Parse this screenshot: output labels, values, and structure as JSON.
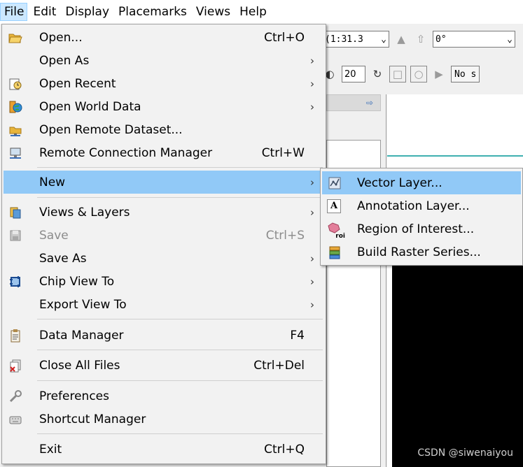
{
  "menubar": {
    "items": [
      {
        "label": "File",
        "active": true
      },
      {
        "label": "Edit"
      },
      {
        "label": "Display"
      },
      {
        "label": "Placemarks"
      },
      {
        "label": "Views"
      },
      {
        "label": "Help"
      }
    ]
  },
  "toolbar": {
    "scale_value": "(1:31.3",
    "rotation_value": "0°",
    "stretch_value": "20",
    "no_stretch_label": "No s"
  },
  "file_menu": {
    "items": [
      {
        "label": "Open...",
        "shortcut": "Ctrl+O",
        "icon": "folder-open-icon"
      },
      {
        "label": "Open As",
        "submenu": true
      },
      {
        "label": "Open Recent",
        "submenu": true,
        "icon": "recent-icon"
      },
      {
        "label": "Open World Data",
        "submenu": true,
        "icon": "globe-icon"
      },
      {
        "label": "Open Remote Dataset...",
        "icon": "remote-dataset-icon"
      },
      {
        "label": "Remote Connection Manager",
        "shortcut": "Ctrl+W",
        "icon": "monitor-icon"
      },
      {
        "label": "New",
        "submenu": true,
        "highlighted": true
      },
      {
        "label": "Views & Layers",
        "submenu": true,
        "icon": "layers-icon"
      },
      {
        "label": "Save",
        "shortcut": "Ctrl+S",
        "disabled": true,
        "icon": "save-icon"
      },
      {
        "label": "Save As",
        "submenu": true
      },
      {
        "label": "Chip View To",
        "submenu": true,
        "icon": "chip-icon"
      },
      {
        "label": "Export View To",
        "submenu": true
      },
      {
        "label": "Data Manager",
        "shortcut": "F4",
        "icon": "clipboard-icon"
      },
      {
        "label": "Close All Files",
        "shortcut": "Ctrl+Del",
        "icon": "close-files-icon"
      },
      {
        "label": "Preferences",
        "icon": "wrench-icon"
      },
      {
        "label": "Shortcut Manager",
        "icon": "keyboard-icon"
      },
      {
        "label": "Exit",
        "shortcut": "Ctrl+Q"
      }
    ]
  },
  "new_submenu": {
    "items": [
      {
        "label": "Vector Layer...",
        "highlighted": true,
        "icon": "vector-layer-icon"
      },
      {
        "label": "Annotation Layer...",
        "icon": "annotation-icon",
        "icon_text": "A"
      },
      {
        "label": "Region of Interest...",
        "icon": "roi-icon",
        "icon_text": "roi"
      },
      {
        "label": "Build Raster Series...",
        "icon": "raster-series-icon"
      }
    ]
  },
  "watermark": "CSDN @siwenaiyou",
  "colors": {
    "menu_highlight": "#91c9f7",
    "menubar_active": "#cce8ff",
    "accent_line": "#3fb0b0"
  }
}
